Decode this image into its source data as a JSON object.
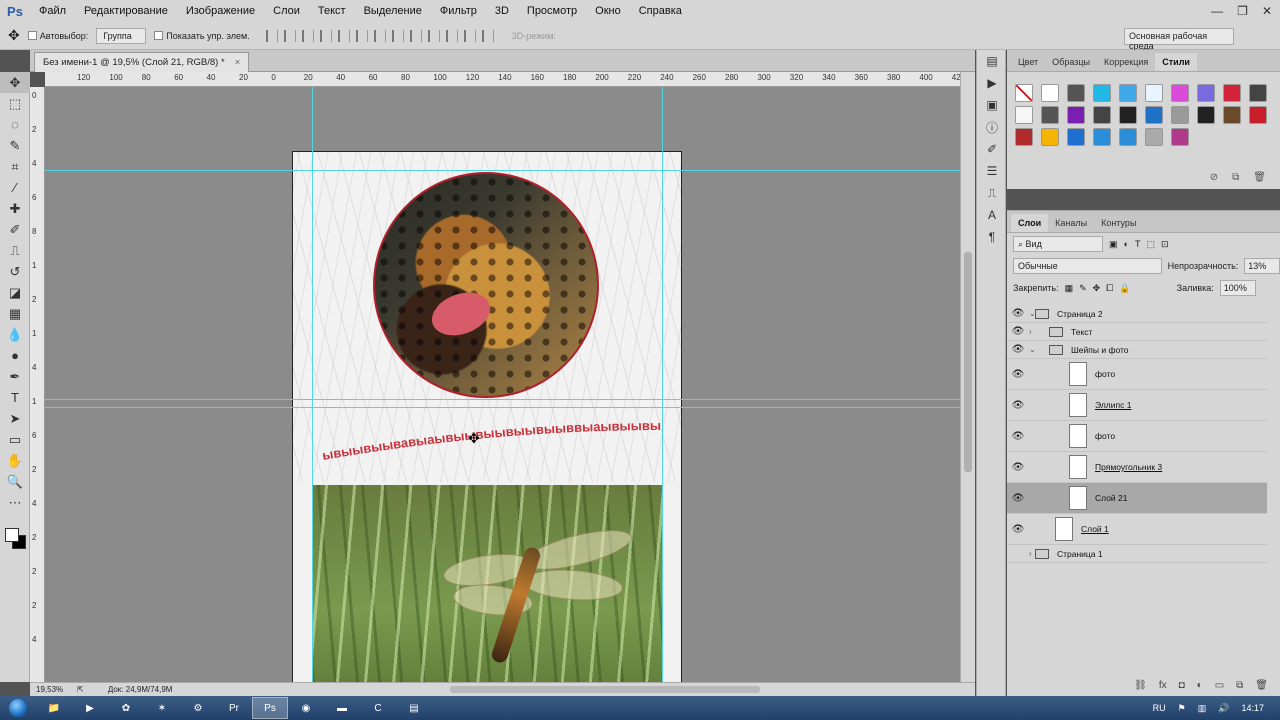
{
  "app": {
    "logo": "Ps"
  },
  "menu": [
    "Файл",
    "Редактирование",
    "Изображение",
    "Слои",
    "Текст",
    "Выделение",
    "Фильтр",
    "3D",
    "Просмотр",
    "Окно",
    "Справка"
  ],
  "options": {
    "autoselect_label": "Автовыбор:",
    "autoselect_value": "Группа",
    "show_controls_label": "Показать упр. элем.",
    "mode_3d_label": "3D-режим:",
    "workspace": "Основная рабочая среда"
  },
  "document": {
    "tab_title": "Без имени-1 @ 19,5% (Слой 21, RGB/8) *",
    "close": "×",
    "curved_text": "ывыывыывавыаывыывыывыывыыввыаывыывыывыыв"
  },
  "ruler": {
    "top": [
      "120",
      "100",
      "80",
      "60",
      "40",
      "20",
      "0",
      "20",
      "40",
      "60",
      "80",
      "100",
      "120",
      "140",
      "160",
      "180",
      "200",
      "220",
      "240",
      "260",
      "280",
      "300",
      "320",
      "340",
      "360",
      "380",
      "400",
      "420",
      "440"
    ],
    "left": [
      "0",
      "2",
      "4",
      "6",
      "8",
      "1",
      "2",
      "1",
      "4",
      "1",
      "6",
      "2",
      "4",
      "2",
      "2",
      "2",
      "4"
    ]
  },
  "status": {
    "zoom": "19,53%",
    "doc_size": "Док: 24,9M/74,9M"
  },
  "swatch_tabs": [
    "Цвет",
    "Образцы",
    "Коррекция",
    "Стили"
  ],
  "swatch_active": "Стили",
  "style_colors": [
    "#ffffff",
    "#555555",
    "#22b8e6",
    "#3fa8e8",
    "#e8f4ff",
    "#d94bd8",
    "#7a6ae0",
    "#d2233a",
    "#444444",
    "#f6f6f6",
    "#555555",
    "#7a1fb0",
    "#444444",
    "#222222",
    "#1e72c8",
    "#9a9a9a",
    "#222222",
    "#6a4a2a",
    "#c8202a",
    "#b02a2a",
    "#f4b400",
    "#1f6fd0",
    "#2a8fd8",
    "#2a8fd8",
    "#aaaaaa",
    "#b03a8a"
  ],
  "layers_tabs": [
    "Слои",
    "Каналы",
    "Контуры"
  ],
  "layers_filter": "Вид",
  "layers_blend": "Обычные",
  "layers_opacity_label": "Непрозрачность:",
  "layers_opacity": "13%",
  "layers_lock_label": "Закрепить:",
  "layers_fill_label": "Заливка:",
  "layers_fill": "100%",
  "layers": [
    {
      "name": "Страница 2",
      "type": "group",
      "indent": 0,
      "visible": true,
      "underline": false
    },
    {
      "name": "Текст",
      "type": "group",
      "indent": 1,
      "visible": true,
      "underline": false
    },
    {
      "name": "Шейпы и фото",
      "type": "group",
      "indent": 1,
      "visible": true,
      "underline": false
    },
    {
      "name": "фото",
      "type": "layer",
      "indent": 2,
      "visible": true,
      "underline": false
    },
    {
      "name": "Эллипс 1",
      "type": "shape",
      "indent": 2,
      "visible": true,
      "underline": true
    },
    {
      "name": "фото",
      "type": "layer",
      "indent": 2,
      "visible": true,
      "underline": false
    },
    {
      "name": "Прямоугольник 3",
      "type": "shape",
      "indent": 2,
      "visible": true,
      "underline": true
    },
    {
      "name": "Слой 21",
      "type": "layer",
      "indent": 2,
      "visible": true,
      "underline": false,
      "selected": true
    },
    {
      "name": "Слой 1",
      "type": "layer",
      "indent": 1,
      "visible": true,
      "underline": true
    },
    {
      "name": "Страница 1",
      "type": "group",
      "indent": 0,
      "visible": false,
      "underline": false
    }
  ],
  "taskbar": {
    "lang": "RU",
    "time": "14:17"
  }
}
